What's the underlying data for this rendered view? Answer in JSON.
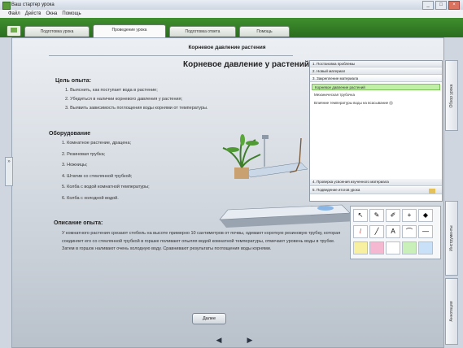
{
  "window": {
    "title": "Ваш стартер урока",
    "buttons": [
      "_",
      "□",
      "×"
    ]
  },
  "menu": [
    "Файл",
    "Действ",
    "Окна",
    "Помощь"
  ],
  "tabs": [
    "Подготовка урока",
    "Проведение урока",
    "Подготовка ответа",
    "Помощь"
  ],
  "page_header": "Корневое давление растения",
  "title": "Корневое давление у растений",
  "goal": {
    "heading": "Цель опыта:",
    "items": [
      "1. Выяснить, как поступает вода в растение;",
      "2. Убедиться в наличии корневого давления у растения;",
      "3. Выявить зависимость поглощения воды корнями от температуры."
    ]
  },
  "equipment": {
    "heading": "Оборудование",
    "items": [
      "1. Комнатное растение, драцена;",
      "2. Резиновая трубка;",
      "3. Ножницы;",
      "4. Штатив со стеклянной трубкой;",
      "5. Колба с водой комнатной температуры;",
      "6. Колба с холодной водой."
    ]
  },
  "description": {
    "heading": "Описание опыта:",
    "text": "У комнатного растения срезают стебель на высоте примерно 10 сантиметров от почвы, одевают короткую резиновую трубку, которая соединяет его со стеклянной трубкой в горшке поливают опыляя водой комнатной температуры, отмечают уровень воды в трубке. Затем в горшок наливают очень холодную воду. Сравнивают результаты поглощения воды корнями."
  },
  "side_panel": {
    "header_items": [
      "1. Постановка проблемы",
      "2. Новый материал",
      "3. Закрепление материала"
    ],
    "selected_items": [
      "Корневое давление растений",
      "Механическая трубочка",
      "Влияние температуры воды на всасывание (t)"
    ],
    "footer_items": [
      "4. Проверка усвоения изученного материала",
      "5. Подведение итогов урока"
    ]
  },
  "vertical_tabs": [
    "Обзор урока",
    "Инструменты",
    "Аннотации"
  ],
  "more_button": "Далее",
  "nav": {
    "prev": "◀",
    "next": "▶"
  },
  "colors": {
    "accent_green": "#3f8f2e",
    "selected_row": "#bff0a6"
  }
}
